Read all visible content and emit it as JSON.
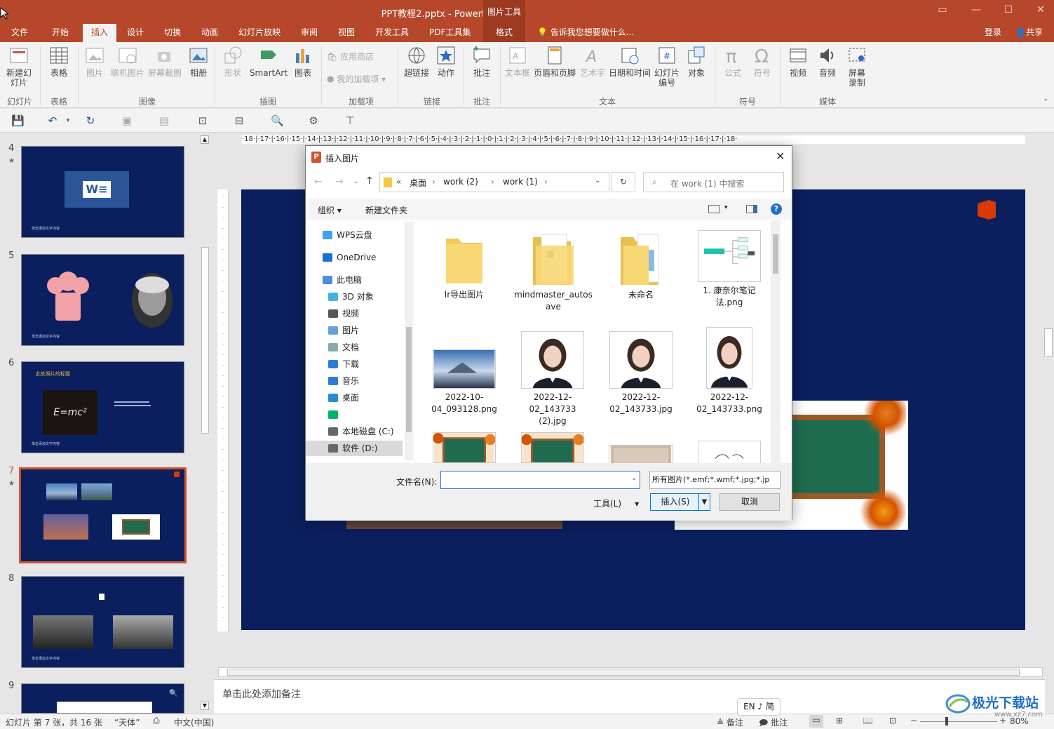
{
  "window": {
    "title": "PPT教程2.pptx - PowerPoint",
    "context_tab": "图片工具",
    "login": "登录",
    "share": "共享"
  },
  "tabs": [
    "文件",
    "开始",
    "插入",
    "设计",
    "切换",
    "动画",
    "幻灯片放映",
    "审阅",
    "视图",
    "开发工具",
    "PDF工具集",
    "格式"
  ],
  "active_tab": "插入",
  "tell_me": "告诉我您想要做什么...",
  "ribbon": {
    "buttons": {
      "new_slide": "新建幻灯片",
      "table": "表格",
      "picture": "图片",
      "online_picture": "联机图片",
      "screenshot": "屏幕截图",
      "album": "相册",
      "shapes": "形状",
      "smartart": "SmartArt",
      "chart": "图表",
      "store": "应用商店",
      "my_addins": "我的加载项",
      "hyperlink": "超链接",
      "action": "动作",
      "comment": "批注",
      "textbox": "文本框",
      "header_footer": "页眉和页脚",
      "wordart": "艺术字",
      "datetime": "日期和时间",
      "slide_number": "幻灯片编号",
      "object": "对象",
      "equation": "公式",
      "symbol": "符号",
      "video": "视频",
      "audio": "音频",
      "screen_record": "屏幕录制"
    },
    "groups": {
      "slides": "幻灯片",
      "tables": "表格",
      "images": "图像",
      "illustrations": "插图",
      "addins": "加载项",
      "links": "链接",
      "comments": "批注",
      "text": "文本",
      "symbols": "符号",
      "media": "媒体"
    }
  },
  "thumbnails": [
    {
      "num": "4",
      "star": true,
      "caption": "单击添加文字内容"
    },
    {
      "num": "5",
      "star": false,
      "caption": "单击添加文字内容"
    },
    {
      "num": "6",
      "star": false,
      "caption": "单击添加文字内容",
      "heading": "此处照片的标题",
      "formula": "E=mc²"
    },
    {
      "num": "7",
      "star": true,
      "selected": true
    },
    {
      "num": "8",
      "star": false,
      "caption": "单击添加文字内容"
    },
    {
      "num": "9",
      "star": false
    }
  ],
  "ruler_h": "·18·|·17·|·16·|·15·|·14·|·13·|·12·|·11·|·10·|·9·|·8·|·7·|·6·|·5·|·4·|·3·|·2·|·1·|·0·|·1·|·2·|·3·|·4·|·5·|·6·|·7·|·8·|·9·|·10·|·11·|·12·|·13·|·14·|·15·|·16·|·17·|·18·",
  "notes_placeholder": "单击此处添加备注",
  "status": {
    "slide_info": "幻灯片 第 7 张，共 16 张",
    "theme": "“天体”",
    "language": "中文(中国)",
    "notes": "备注",
    "comments": "批注",
    "zoom": "80%",
    "ime": "EN ♪ 简"
  },
  "watermark": {
    "text": "极光下载站",
    "url": "www.xz7.com"
  },
  "dialog": {
    "title": "插入图片",
    "breadcrumb": [
      "«",
      "桌面",
      "work (2)",
      "work (1)"
    ],
    "search_placeholder": "在 work (1) 中搜索",
    "organize": "组织 ▾",
    "new_folder": "新建文件夹",
    "nav": [
      {
        "label": "WPS云盘",
        "color": "#3aa1ff"
      },
      {
        "label": "OneDrive",
        "color": "#1b6fd6"
      },
      {
        "label": "此电脑",
        "color": "#4a90d9"
      },
      {
        "label": "3D 对象",
        "color": "#45b3e0"
      },
      {
        "label": "视频",
        "color": "#555"
      },
      {
        "label": "图片",
        "color": "#6aa0d8"
      },
      {
        "label": "文档",
        "color": "#8aa"
      },
      {
        "label": "下载",
        "color": "#2b7cd3"
      },
      {
        "label": "音乐",
        "color": "#2b7cd3"
      },
      {
        "label": "桌面",
        "color": "#2b8ad3"
      },
      {
        "label": "",
        "color": "#00b26a"
      },
      {
        "label": "本地磁盘 (C:)",
        "color": "#666"
      },
      {
        "label": "软件 (D:)",
        "color": "#666"
      }
    ],
    "files": [
      {
        "name": "lr导出图片",
        "kind": "folder"
      },
      {
        "name": "mindmaster_autosave",
        "kind": "folder-doc"
      },
      {
        "name": "未命名",
        "kind": "folder-doc"
      },
      {
        "name": "1. 康奈尔笔记法.png",
        "kind": "mindmap"
      },
      {
        "name": "2022-10-04_093128.png",
        "kind": "landscape"
      },
      {
        "name": "2022-12-02_143733 (2).jpg",
        "kind": "portrait"
      },
      {
        "name": "2022-12-02_143733.jpg",
        "kind": "portrait"
      },
      {
        "name": "2022-12-02_143733.png",
        "kind": "portrait"
      },
      {
        "name": "",
        "kind": "board"
      },
      {
        "name": "",
        "kind": "board"
      },
      {
        "name": "",
        "kind": "paper"
      },
      {
        "name": "",
        "kind": "note"
      }
    ],
    "filename_label": "文件名(N):",
    "filename_value": "",
    "filter": "所有图片(*.emf;*.wmf;*.jpg;*.jp",
    "tools": "工具(L)",
    "insert": "插入(S)",
    "cancel": "取消"
  }
}
